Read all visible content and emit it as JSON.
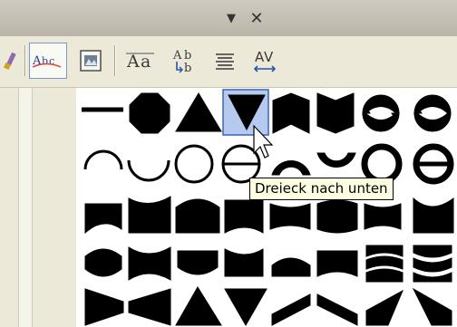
{
  "window": {
    "dropdown_glyph": "▼",
    "close_glyph": "✕"
  },
  "toolbar": {
    "tools": [
      {
        "icon": "paint-brush-icon",
        "label": ""
      },
      {
        "icon": "text-style-icon",
        "label": "Abc",
        "active": true
      },
      {
        "icon": "insert-wordart-icon",
        "label": ""
      },
      {
        "icon": "same-letter-heights-icon",
        "label": "Aa"
      },
      {
        "icon": "vertical-text-icon",
        "label": "Ab/b"
      },
      {
        "icon": "align-text-icon",
        "label": ""
      },
      {
        "icon": "character-spacing-icon",
        "label": "AV"
      }
    ]
  },
  "gallery": {
    "hovered_shape": "Dreieck nach unten",
    "rows": [
      [
        "line",
        "octagon",
        "triangle-up",
        "triangle-down",
        "chevron-up",
        "chevron-down",
        "circle-arrows",
        "circle-arrows-2"
      ],
      [
        "arch-up",
        "arch-down",
        "circle",
        "circle-slash",
        "arch-up-thick",
        "arch-down-thick",
        "ring",
        "ring-bar"
      ],
      [
        "wave-1",
        "wave-2",
        "inflate-top",
        "deflate-bottom",
        "wave-3",
        "wave-4",
        "wave-5",
        "wave-6"
      ],
      [
        "inflate",
        "deflate",
        "inflate-bottom",
        "deflate-top",
        "inflate-top-2",
        "deflate-bottom-2",
        "fade-up",
        "fade-down"
      ],
      [
        "fade-right",
        "fade-left",
        "slant-up",
        "slant-down",
        "cascade-up",
        "cascade-down",
        "can-up",
        "can-down"
      ]
    ]
  },
  "tooltip": {
    "text": "Dreieck nach unten"
  }
}
